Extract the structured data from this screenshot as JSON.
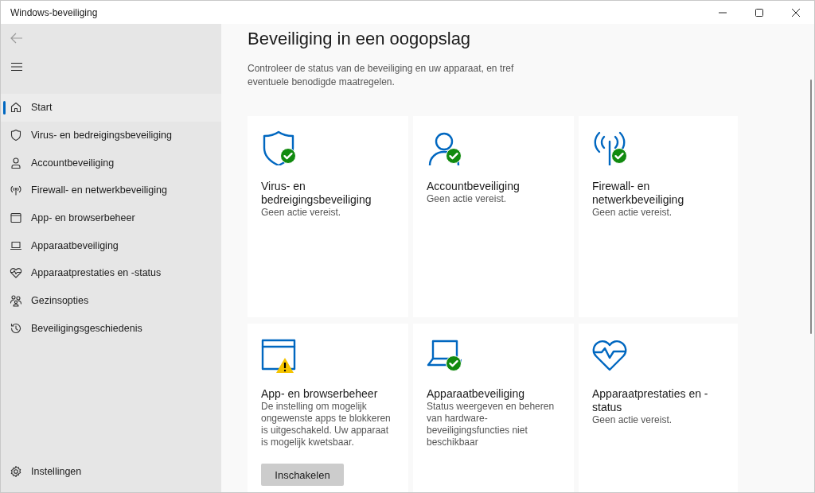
{
  "window": {
    "title": "Windows-beveiliging"
  },
  "sidebar": {
    "items": [
      {
        "label": "Start",
        "selected": true
      },
      {
        "label": "Virus- en bedreigingsbeveiliging",
        "selected": false
      },
      {
        "label": "Accountbeveiliging",
        "selected": false
      },
      {
        "label": "Firewall- en netwerkbeveiliging",
        "selected": false
      },
      {
        "label": "App- en browserbeheer",
        "selected": false
      },
      {
        "label": "Apparaatbeveiliging",
        "selected": false
      },
      {
        "label": "Apparaatprestaties en -status",
        "selected": false
      },
      {
        "label": "Gezinsopties",
        "selected": false
      },
      {
        "label": "Beveiligingsgeschiedenis",
        "selected": false
      }
    ],
    "settings": {
      "label": "Instellingen"
    }
  },
  "main": {
    "heading": "Beveiliging in een oogopslag",
    "description": "Controleer de status van de beveiliging en uw apparaat, en tref eventuele benodigde maatregelen.",
    "cards": [
      {
        "title": "Virus- en bedreigingsbeveiliging",
        "status_text": "Geen actie vereist.",
        "kind": "ok"
      },
      {
        "title": "Accountbeveiliging",
        "status_text": "Geen actie vereist.",
        "kind": "ok"
      },
      {
        "title": "Firewall- en netwerkbeveiliging",
        "status_text": "Geen actie vereist.",
        "kind": "ok"
      },
      {
        "title": "App- en browserbeheer",
        "status_text": "De instelling om mogelijk ongewenste apps te blokkeren is uitgeschakeld. Uw apparaat is mogelijk kwetsbaar.",
        "kind": "warning",
        "button": "Inschakelen"
      },
      {
        "title": "Apparaatbeveiliging",
        "status_text": "Status weergeven en beheren van hardware-beveiligingsfuncties niet beschikbaar",
        "kind": "ok"
      },
      {
        "title": "Apparaatprestaties en -status",
        "status_text": "Geen actie vereist.",
        "kind": "plain"
      }
    ]
  }
}
